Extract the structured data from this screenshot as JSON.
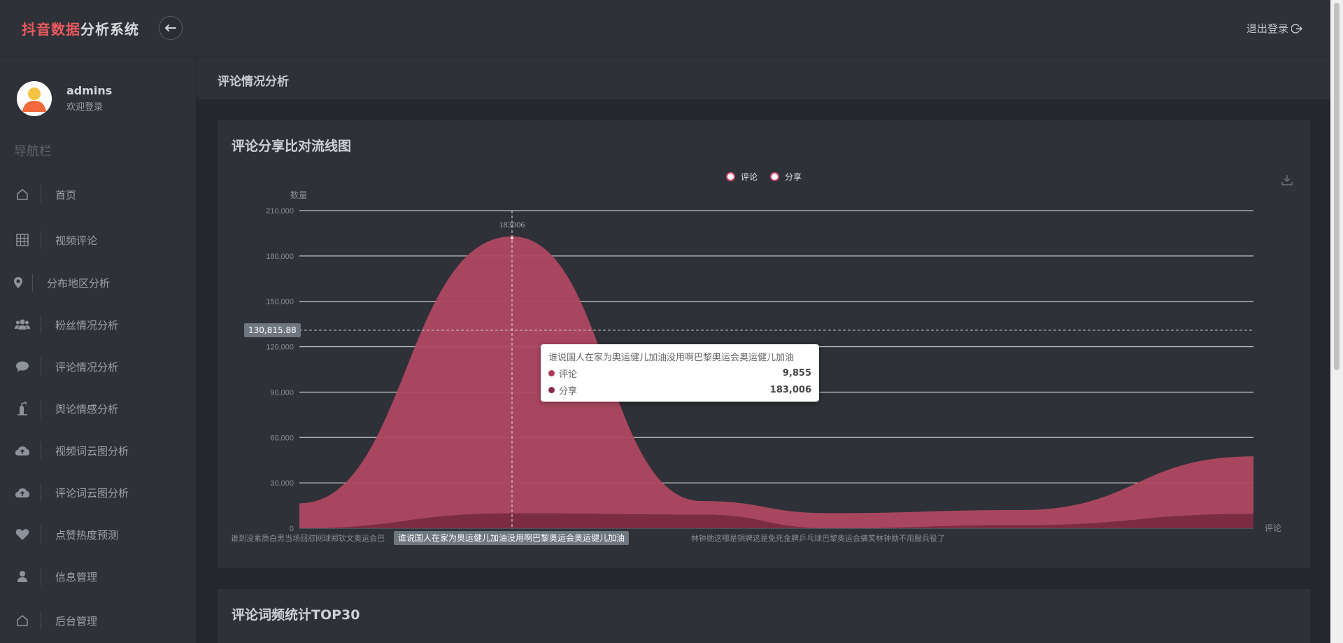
{
  "app": {
    "brand_part1": "抖音数据",
    "brand_part2": "分析系统",
    "logout_label": "退出登录"
  },
  "user": {
    "name": "admins",
    "welcome": "欢迎登录"
  },
  "sidebar": {
    "title": "导航栏",
    "items": [
      {
        "label": "首页",
        "icon": "home-icon"
      },
      {
        "label": "视频评论",
        "icon": "table-icon"
      },
      {
        "label": "分布地区分析",
        "icon": "map-marker-icon"
      },
      {
        "label": "粉丝情况分析",
        "icon": "users-icon"
      },
      {
        "label": "评论情况分析",
        "icon": "comment-icon"
      },
      {
        "label": "舆论情感分析",
        "icon": "fire-extinguisher-icon"
      },
      {
        "label": "视频词云图分析",
        "icon": "cloud-upload-icon"
      },
      {
        "label": "评论词云图分析",
        "icon": "cloud-upload-icon"
      },
      {
        "label": "点赞热度预测",
        "icon": "heart-icon"
      },
      {
        "label": "信息管理",
        "icon": "user-icon"
      },
      {
        "label": "后台管理",
        "icon": "home-icon"
      }
    ]
  },
  "page": {
    "title": "评论情况分析"
  },
  "panel1": {
    "title": "评论分享比对流线图"
  },
  "panel2": {
    "title": "评论词频统计TOP30"
  },
  "tooltip": {
    "title": "谁说国人在家为奥运健儿加油没用啊巴黎奥运会奥运健儿加油",
    "rows": [
      {
        "name": "评论",
        "value": "9,855"
      },
      {
        "name": "分享",
        "value": "183,006"
      }
    ]
  },
  "axis_pointer": {
    "y_value": "130,815.88",
    "x_value": "谁说国人在家为奥运健儿加油没用啊巴黎奥运会奥运健儿加油"
  },
  "chart_data": {
    "type": "area",
    "title": "",
    "legend": [
      "评论",
      "分享"
    ],
    "legend_position": "top-center",
    "ylabel": "数量",
    "xlabel": "",
    "ylim": [
      0,
      210000
    ],
    "y_ticks": [
      "0",
      "30,000",
      "60,000",
      "90,000",
      "120,000",
      "150,000",
      "180,000",
      "210,000"
    ],
    "x_visible_labels": [
      {
        "text": "谁到没素质白男当场回怼网球郑钦文奥运会巴",
        "index": 0
      },
      {
        "text": "林钟勋这哪是铜牌这是免死金牌乒乓球巴黎奥运会搞笑林钟勋不用服兵役了",
        "index": 3
      }
    ],
    "series_axis_label": "评论",
    "categories_count": 6,
    "series": [
      {
        "name": "评论",
        "color": "#8a2b44",
        "values": [
          0,
          9855,
          9000,
          0,
          2000,
          9500
        ]
      },
      {
        "name": "分享",
        "color": "#b04861",
        "values": [
          16500,
          183006,
          9000,
          10000,
          10000,
          38000
        ]
      }
    ],
    "marker_label": "183006",
    "grid": true
  },
  "colors": {
    "accent": "#ea5a5f",
    "bg": "#24272c",
    "panel": "#2e3137"
  }
}
